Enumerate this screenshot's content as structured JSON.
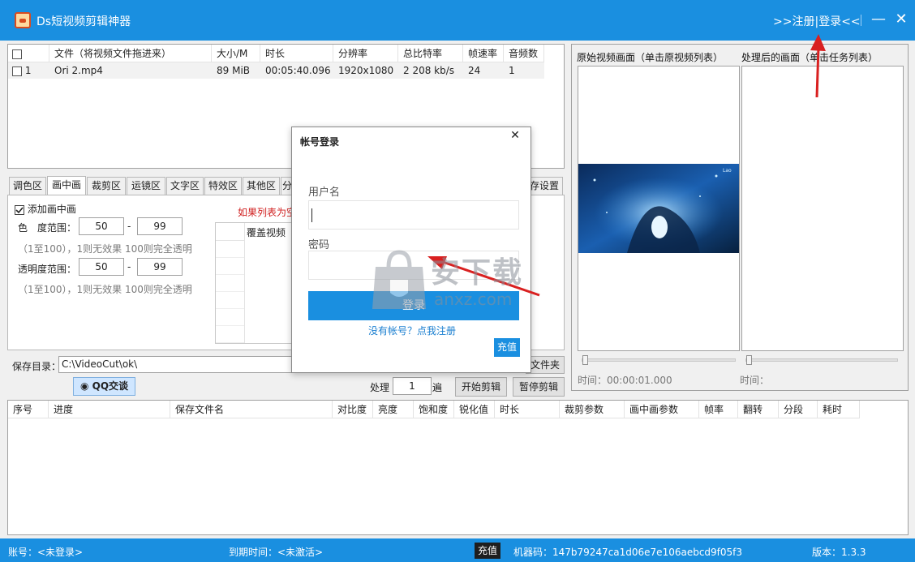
{
  "app": {
    "title": "Ds短视频剪辑神器",
    "register_prefix": ">>",
    "register_label": "注册",
    "login_divider": "|",
    "login_label": "登录",
    "login_suffix": "<<",
    "minimize": "—",
    "close": "✕"
  },
  "file_table": {
    "columns": [
      "文件（将视频文件拖进来）",
      "大小/M",
      "时长",
      "分辨率",
      "总比特率",
      "帧速率",
      "音频数"
    ],
    "rows": [
      {
        "index": "1",
        "file": "Ori 2.mp4",
        "size": "89 MiB",
        "duration": "00:05:40.096",
        "resolution": "1920x1080",
        "bitrate": "2 208 kb/s",
        "fps": "24",
        "audio": "1"
      }
    ]
  },
  "tabs": [
    "调色区",
    "画中画",
    "裁剪区",
    "运镜区",
    "文字区",
    "特效区",
    "其他区",
    "分",
    "存设置"
  ],
  "pip": {
    "enable_label": "添加画中画",
    "color_range_label": "色　度范围：",
    "color_min": "50",
    "color_max": "99",
    "dash": "-",
    "hint": "（1至100），1则无效果 100则完全透明",
    "alpha_range_label": "透明度范围：",
    "alpha_min": "50",
    "alpha_max": "99",
    "warning": "如果列表为空",
    "cover_column": "覆盖视频"
  },
  "preview": {
    "original_label": "原始视频画面（单击原视频列表）",
    "processed_label": "处理后的画面（单击任务列表）",
    "time1_label": "时间：00:00:01.000",
    "time2_label": "时间：",
    "thumb_caption": "Lao"
  },
  "save": {
    "dir_label": "保存目录：",
    "dir_value": "C:\\VideoCut\\ok\\",
    "folder_button": "文件夹",
    "qq_button": "QQ交谈",
    "process_label": "处理",
    "process_count": "1",
    "process_unit": "遍",
    "start_button": "开始剪辑",
    "pause_button": "暂停剪辑"
  },
  "task_table": {
    "columns": [
      "序号",
      "进度",
      "保存文件名",
      "对比度",
      "亮度",
      "饱和度",
      "锐化值",
      "时长",
      "裁剪参数",
      "画中画参数",
      "帧率",
      "翻转",
      "分段",
      "耗时"
    ]
  },
  "login_dialog": {
    "title": "帐号登录",
    "close": "✕",
    "username_label": "用户名",
    "password_label": "密码",
    "login_button": "登录",
    "register_link": "没有帐号？点我注册",
    "recharge_button": "充值"
  },
  "statusbar": {
    "account": "账号：<未登录>",
    "expiry": "到期时间：<未激活>",
    "recharge": "充值",
    "machine_code": "机器码：147b79247ca1d06e7e106aebcd9f05f3",
    "version": "版本：1.3.3"
  },
  "watermark": {
    "cn": "安下载",
    "en": "anxz.com"
  },
  "colors": {
    "accent": "#1a8fe0",
    "annotation_arrow": "#d92020",
    "warning_text": "#d02020"
  }
}
